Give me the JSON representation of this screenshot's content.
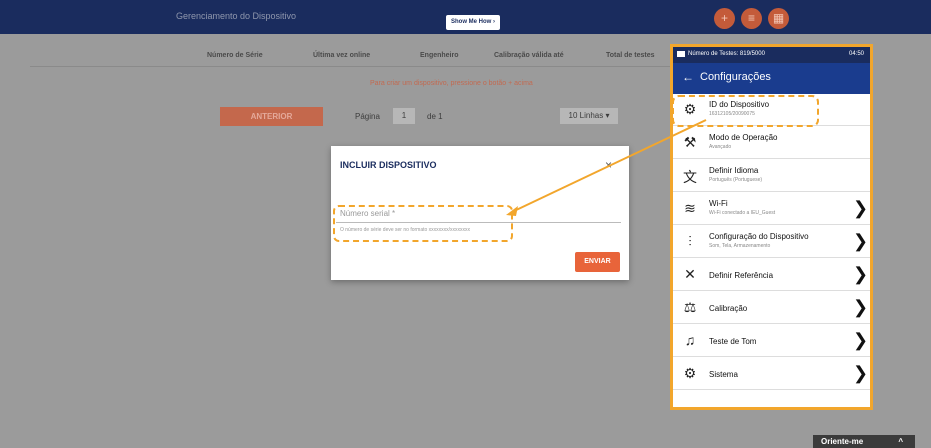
{
  "header": {
    "title": "Gerenciamento do Dispositivo",
    "show_me_how": "Show Me How ›",
    "buttons": [
      "+",
      "≡",
      "▦"
    ]
  },
  "table": {
    "columns": [
      "Número de Série",
      "Última vez online",
      "Engenheiro",
      "Calibração válida até",
      "Total de testes"
    ],
    "hint": "Para criar um dispositivo, pressione o botão + acima"
  },
  "pagination": {
    "prev_label": "ANTERIOR",
    "page_label": "Página",
    "page_value": "1",
    "of_label": "de 1",
    "lines_label": "10 Linhas"
  },
  "modal": {
    "title": "INCLUIR DISPOSITIVO",
    "close": "×",
    "serial_placeholder": "Número serial *",
    "help": "O número de série deve ser no formato xxxxxxxx/xxxxxxxx",
    "send_label": "ENVIAR"
  },
  "phone": {
    "status_left": "Número de Testes: 819/5000",
    "status_right": "04:50",
    "back_arrow": "←",
    "header_title": "Configurações",
    "items": [
      {
        "title": "ID do Dispositivo",
        "subtitle": "16312105/20090075",
        "chevron": ""
      },
      {
        "title": "Modo de Operação",
        "subtitle": "Avançado",
        "chevron": ""
      },
      {
        "title": "Definir Idioma",
        "subtitle": "Português (Portuguese)",
        "chevron": ""
      },
      {
        "title": "Wi-Fi",
        "subtitle": "Wi-Fi conectado a IEU_Guest",
        "chevron": "❯"
      },
      {
        "title": "Configuração do Dispositivo",
        "subtitle": "Som, Tela, Armazenamento",
        "chevron": "❯"
      },
      {
        "title": "Definir Referência",
        "subtitle": "",
        "chevron": "❯"
      },
      {
        "title": "Calibração",
        "subtitle": "",
        "chevron": "❯"
      },
      {
        "title": "Teste de Tom",
        "subtitle": "",
        "chevron": "❯"
      },
      {
        "title": "Sistema",
        "subtitle": "",
        "chevron": "❯"
      }
    ],
    "icons": [
      "⚙",
      "⚒",
      "文",
      "≋",
      "⫶",
      "✕",
      "⚖",
      "♫",
      "⚙"
    ]
  },
  "orient_label": "Oriente-me",
  "orient_caret": "^",
  "colors": {
    "accent": "#f2a62c",
    "navy": "#1a2c5e",
    "orange": "#e8643a"
  }
}
